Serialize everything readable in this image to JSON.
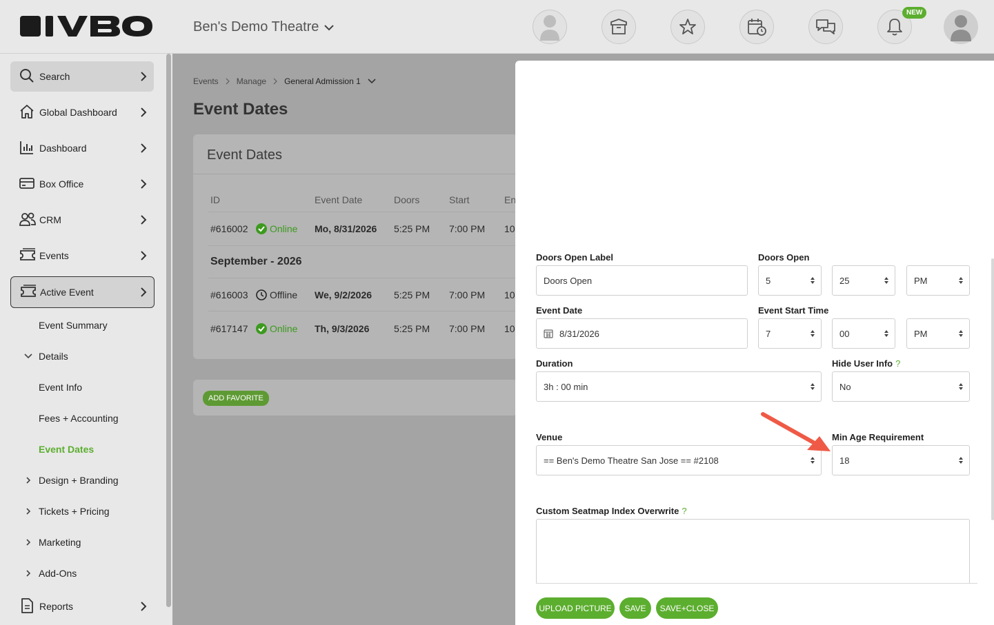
{
  "header": {
    "logo_text": "IVBO",
    "venue": "Ben's Demo Theatre",
    "new_badge": "NEW"
  },
  "sidebar": {
    "items": [
      {
        "label": "Search"
      },
      {
        "label": "Global Dashboard"
      },
      {
        "label": "Dashboard"
      },
      {
        "label": "Box Office"
      },
      {
        "label": "CRM"
      },
      {
        "label": "Events"
      },
      {
        "label": "Active Event"
      }
    ],
    "sub": {
      "event_summary": "Event Summary",
      "details": "Details",
      "event_info": "Event Info",
      "fees": "Fees + Accounting",
      "event_dates": "Event Dates",
      "design": "Design + Branding",
      "tickets": "Tickets + Pricing",
      "marketing": "Marketing",
      "addons": "Add-Ons"
    },
    "reports": "Reports"
  },
  "breadcrumb": [
    "Events",
    "Manage",
    "General Admission 1"
  ],
  "page_title": "Event Dates",
  "card": {
    "title": "Event Dates",
    "columns": [
      "ID",
      "Event Date",
      "Doors",
      "Start",
      "En"
    ],
    "rows": [
      {
        "id": "#616002",
        "status": "Online",
        "date": "Mo, 8/31/2026",
        "doors": "5:25 PM",
        "start": "7:00 PM",
        "end": "10"
      },
      {
        "id": "#616003",
        "status": "Offline",
        "date": "We, 9/2/2026",
        "doors": "5:25 PM",
        "start": "7:00 PM",
        "end": "10"
      },
      {
        "id": "#617147",
        "status": "Online",
        "date": "Th, 9/3/2026",
        "doors": "5:25 PM",
        "start": "7:00 PM",
        "end": "10"
      }
    ],
    "group_heading": "September - 2026"
  },
  "fav_button": "ADD FAVORITE",
  "form": {
    "doors_open_label": {
      "label": "Doors Open Label",
      "value": "Doors Open"
    },
    "doors_open": {
      "label": "Doors Open",
      "hour": "5",
      "minute": "25",
      "ampm": "PM"
    },
    "event_date": {
      "label": "Event Date",
      "value": "8/31/2026"
    },
    "event_start": {
      "label": "Event Start Time",
      "hour": "7",
      "minute": "00",
      "ampm": "PM"
    },
    "duration": {
      "label": "Duration",
      "value": "3h : 00 min"
    },
    "hide_user_info": {
      "label": "Hide User Info",
      "help": "?",
      "value": "No"
    },
    "venue": {
      "label": "Venue",
      "value": "== Ben's Demo Theatre San Jose == #2108"
    },
    "min_age": {
      "label": "Min Age Requirement",
      "value": "18"
    },
    "seatmap": {
      "label": "Custom Seatmap Index Overwrite",
      "help": "?"
    }
  },
  "buttons": {
    "upload": "UPLOAD PICTURE",
    "save": "SAVE",
    "save_close": "SAVE+CLOSE"
  },
  "colors": {
    "accent": "#5cae2f",
    "annotation_arrow": "#ef5a46"
  }
}
